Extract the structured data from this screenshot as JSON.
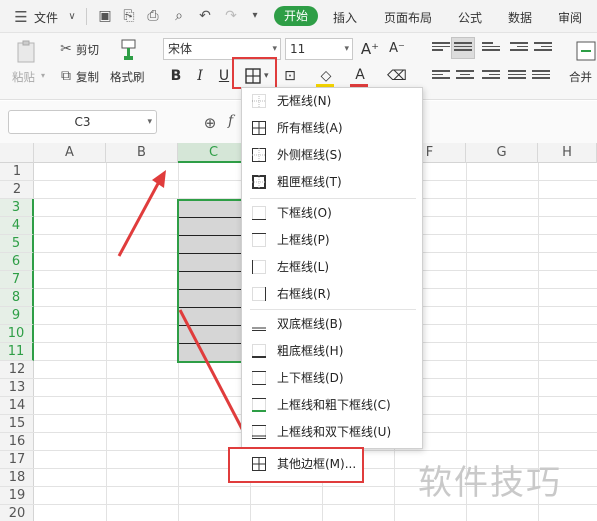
{
  "menubar": {
    "file_label": "文件",
    "tabs": [
      "开始",
      "插入",
      "页面布局",
      "公式",
      "数据",
      "审阅"
    ],
    "active_tab": "开始",
    "accent_color": "#2e9e46"
  },
  "ribbon": {
    "paste_label": "粘贴",
    "cut_label": "剪切",
    "copy_label": "复制",
    "format_painter_label": "格式刷",
    "font_name": "宋体",
    "font_size": "11",
    "merge_label": "合并"
  },
  "formula_bar": {
    "name_box": "C3"
  },
  "grid": {
    "columns": [
      "A",
      "B",
      "C",
      "D",
      "E",
      "F",
      "G",
      "H"
    ],
    "selected_column": "C",
    "rows": [
      "1",
      "2",
      "3",
      "4",
      "5",
      "6",
      "7",
      "8",
      "9",
      "10",
      "11",
      "12",
      "13",
      "14",
      "15",
      "16",
      "17",
      "18",
      "19",
      "20"
    ],
    "selected_rows": [
      "3",
      "4",
      "5",
      "6",
      "7",
      "8",
      "9",
      "10",
      "11"
    ]
  },
  "border_menu": {
    "items": [
      {
        "label": "无框线(N)",
        "icon": "no-border-icon"
      },
      {
        "label": "所有框线(A)",
        "icon": "all-borders-icon"
      },
      {
        "label": "外侧框线(S)",
        "icon": "outside-borders-icon"
      },
      {
        "label": "粗匣框线(T)",
        "icon": "thick-box-border-icon"
      },
      {
        "label": "下框线(O)",
        "icon": "bottom-border-icon"
      },
      {
        "label": "上框线(P)",
        "icon": "top-border-icon"
      },
      {
        "label": "左框线(L)",
        "icon": "left-border-icon"
      },
      {
        "label": "右框线(R)",
        "icon": "right-border-icon"
      },
      {
        "label": "双底框线(B)",
        "icon": "double-bottom-border-icon"
      },
      {
        "label": "粗底框线(H)",
        "icon": "thick-bottom-border-icon"
      },
      {
        "label": "上下框线(D)",
        "icon": "top-bottom-border-icon"
      },
      {
        "label": "上框线和粗下框线(C)",
        "icon": "top-thick-bottom-border-icon"
      },
      {
        "label": "上框线和双下框线(U)",
        "icon": "top-double-bottom-border-icon"
      },
      {
        "label": "其他边框(M)...",
        "icon": "more-borders-icon"
      }
    ]
  },
  "watermark": "软件技巧",
  "highlight_color": "#e03c3c"
}
